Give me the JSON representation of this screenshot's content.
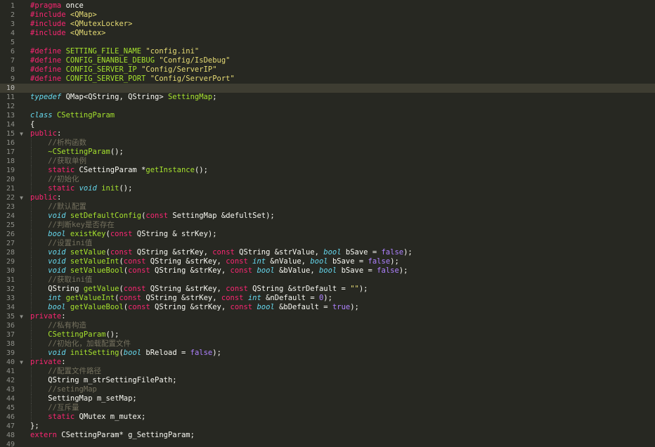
{
  "editor": {
    "theme": "monokai",
    "colors": {
      "background": "#272822",
      "active_line": "#3e3d32",
      "line_number": "#8f908a",
      "text": "#f8f8f2",
      "keyword": "#f92672",
      "type": "#66d9ef",
      "function": "#a6e22e",
      "string": "#e6db74",
      "number": "#ae81ff",
      "comment": "#75715e"
    },
    "active_line": 10,
    "lines": [
      {
        "n": "1",
        "tokens": [
          {
            "t": "#pragma",
            "c": "pp"
          },
          {
            "t": " once",
            "c": "tx"
          }
        ]
      },
      {
        "n": "2",
        "tokens": [
          {
            "t": "#include",
            "c": "pp"
          },
          {
            "t": " ",
            "c": "tx"
          },
          {
            "t": "<QMap>",
            "c": "str"
          }
        ]
      },
      {
        "n": "3",
        "tokens": [
          {
            "t": "#include",
            "c": "pp"
          },
          {
            "t": " ",
            "c": "tx"
          },
          {
            "t": "<QMutexLocker>",
            "c": "str"
          }
        ]
      },
      {
        "n": "4",
        "tokens": [
          {
            "t": "#include",
            "c": "pp"
          },
          {
            "t": " ",
            "c": "tx"
          },
          {
            "t": "<QMutex>",
            "c": "str"
          }
        ]
      },
      {
        "n": "5",
        "tokens": []
      },
      {
        "n": "6",
        "tokens": [
          {
            "t": "#define",
            "c": "pp"
          },
          {
            "t": " ",
            "c": "tx"
          },
          {
            "t": "SETTING_FILE_NAME",
            "c": "fn"
          },
          {
            "t": " ",
            "c": "tx"
          },
          {
            "t": "\"config.ini\"",
            "c": "str"
          }
        ]
      },
      {
        "n": "7",
        "tokens": [
          {
            "t": "#define",
            "c": "pp"
          },
          {
            "t": " ",
            "c": "tx"
          },
          {
            "t": "CONFIG_ENANBLE_DEBUG",
            "c": "fn"
          },
          {
            "t": " ",
            "c": "tx"
          },
          {
            "t": "\"Config/IsDebug\"",
            "c": "str"
          }
        ]
      },
      {
        "n": "8",
        "tokens": [
          {
            "t": "#define",
            "c": "pp"
          },
          {
            "t": " ",
            "c": "tx"
          },
          {
            "t": "CONFIG_SERVER_IP",
            "c": "fn"
          },
          {
            "t": " ",
            "c": "tx"
          },
          {
            "t": "\"Config/ServerIP\"",
            "c": "str"
          }
        ]
      },
      {
        "n": "9",
        "tokens": [
          {
            "t": "#define",
            "c": "pp"
          },
          {
            "t": " ",
            "c": "tx"
          },
          {
            "t": "CONFIG_SERVER_PORT",
            "c": "fn"
          },
          {
            "t": " ",
            "c": "tx"
          },
          {
            "t": "\"Config/ServerPort\"",
            "c": "str"
          }
        ]
      },
      {
        "n": "10",
        "tokens": []
      },
      {
        "n": "11",
        "tokens": [
          {
            "t": "typedef",
            "c": "type"
          },
          {
            "t": " QMap<QString, QString> ",
            "c": "tx"
          },
          {
            "t": "SettingMap",
            "c": "cls"
          },
          {
            "t": ";",
            "c": "tx"
          }
        ]
      },
      {
        "n": "12",
        "tokens": []
      },
      {
        "n": "13",
        "tokens": [
          {
            "t": "class",
            "c": "type"
          },
          {
            "t": " ",
            "c": "tx"
          },
          {
            "t": "CSettingParam",
            "c": "cls"
          }
        ]
      },
      {
        "n": "14",
        "tokens": [
          {
            "t": "{",
            "c": "tx"
          }
        ]
      },
      {
        "n": "15",
        "fold": true,
        "tokens": [
          {
            "t": "public",
            "c": "kw"
          },
          {
            "t": ":",
            "c": "tx"
          }
        ]
      },
      {
        "n": "16",
        "indent": 1,
        "tokens": [
          {
            "t": "    ",
            "c": "tx"
          },
          {
            "t": "//析构函数",
            "c": "cm"
          }
        ]
      },
      {
        "n": "17",
        "indent": 1,
        "tokens": [
          {
            "t": "    ",
            "c": "tx"
          },
          {
            "t": "~CSettingParam",
            "c": "fn"
          },
          {
            "t": "();",
            "c": "tx"
          }
        ]
      },
      {
        "n": "18",
        "indent": 1,
        "tokens": [
          {
            "t": "    ",
            "c": "tx"
          },
          {
            "t": "//获取单例",
            "c": "cm"
          }
        ]
      },
      {
        "n": "19",
        "indent": 1,
        "tokens": [
          {
            "t": "    ",
            "c": "tx"
          },
          {
            "t": "static",
            "c": "kw"
          },
          {
            "t": " CSettingParam *",
            "c": "tx"
          },
          {
            "t": "getInstance",
            "c": "fn"
          },
          {
            "t": "();",
            "c": "tx"
          }
        ]
      },
      {
        "n": "20",
        "indent": 1,
        "tokens": [
          {
            "t": "    ",
            "c": "tx"
          },
          {
            "t": "//初始化",
            "c": "cm"
          }
        ]
      },
      {
        "n": "21",
        "indent": 1,
        "tokens": [
          {
            "t": "    ",
            "c": "tx"
          },
          {
            "t": "static",
            "c": "kw"
          },
          {
            "t": " ",
            "c": "tx"
          },
          {
            "t": "void",
            "c": "type"
          },
          {
            "t": " ",
            "c": "tx"
          },
          {
            "t": "init",
            "c": "fn"
          },
          {
            "t": "();",
            "c": "tx"
          }
        ]
      },
      {
        "n": "22",
        "fold": true,
        "tokens": [
          {
            "t": "public",
            "c": "kw"
          },
          {
            "t": ":",
            "c": "tx"
          }
        ]
      },
      {
        "n": "23",
        "indent": 1,
        "tokens": [
          {
            "t": "    ",
            "c": "tx"
          },
          {
            "t": "//默认配置",
            "c": "cm"
          }
        ]
      },
      {
        "n": "24",
        "indent": 1,
        "tokens": [
          {
            "t": "    ",
            "c": "tx"
          },
          {
            "t": "void",
            "c": "type"
          },
          {
            "t": " ",
            "c": "tx"
          },
          {
            "t": "setDefaultConfig",
            "c": "fn"
          },
          {
            "t": "(",
            "c": "tx"
          },
          {
            "t": "const",
            "c": "kw"
          },
          {
            "t": " SettingMap &defultSet);",
            "c": "tx"
          }
        ]
      },
      {
        "n": "25",
        "indent": 1,
        "tokens": [
          {
            "t": "    ",
            "c": "tx"
          },
          {
            "t": "//判断key是否存在",
            "c": "cm"
          }
        ]
      },
      {
        "n": "26",
        "indent": 1,
        "tokens": [
          {
            "t": "    ",
            "c": "tx"
          },
          {
            "t": "bool",
            "c": "type"
          },
          {
            "t": " ",
            "c": "tx"
          },
          {
            "t": "existKey",
            "c": "fn"
          },
          {
            "t": "(",
            "c": "tx"
          },
          {
            "t": "const",
            "c": "kw"
          },
          {
            "t": " QString & strKey);",
            "c": "tx"
          }
        ]
      },
      {
        "n": "27",
        "indent": 1,
        "tokens": [
          {
            "t": "    ",
            "c": "tx"
          },
          {
            "t": "//设置ini值",
            "c": "cm"
          }
        ]
      },
      {
        "n": "28",
        "indent": 1,
        "tokens": [
          {
            "t": "    ",
            "c": "tx"
          },
          {
            "t": "void",
            "c": "type"
          },
          {
            "t": " ",
            "c": "tx"
          },
          {
            "t": "setValue",
            "c": "fn"
          },
          {
            "t": "(",
            "c": "tx"
          },
          {
            "t": "const",
            "c": "kw"
          },
          {
            "t": " QString &strKey, ",
            "c": "tx"
          },
          {
            "t": "const",
            "c": "kw"
          },
          {
            "t": " QString &strValue, ",
            "c": "tx"
          },
          {
            "t": "bool",
            "c": "type"
          },
          {
            "t": " bSave = ",
            "c": "tx"
          },
          {
            "t": "false",
            "c": "num"
          },
          {
            "t": ");",
            "c": "tx"
          }
        ]
      },
      {
        "n": "29",
        "indent": 1,
        "tokens": [
          {
            "t": "    ",
            "c": "tx"
          },
          {
            "t": "void",
            "c": "type"
          },
          {
            "t": " ",
            "c": "tx"
          },
          {
            "t": "setValueInt",
            "c": "fn"
          },
          {
            "t": "(",
            "c": "tx"
          },
          {
            "t": "const",
            "c": "kw"
          },
          {
            "t": " QString &strKey, ",
            "c": "tx"
          },
          {
            "t": "const",
            "c": "kw"
          },
          {
            "t": " ",
            "c": "tx"
          },
          {
            "t": "int",
            "c": "type"
          },
          {
            "t": " &nValue, ",
            "c": "tx"
          },
          {
            "t": "bool",
            "c": "type"
          },
          {
            "t": " bSave = ",
            "c": "tx"
          },
          {
            "t": "false",
            "c": "num"
          },
          {
            "t": ");",
            "c": "tx"
          }
        ]
      },
      {
        "n": "30",
        "indent": 1,
        "tokens": [
          {
            "t": "    ",
            "c": "tx"
          },
          {
            "t": "void",
            "c": "type"
          },
          {
            "t": " ",
            "c": "tx"
          },
          {
            "t": "setValueBool",
            "c": "fn"
          },
          {
            "t": "(",
            "c": "tx"
          },
          {
            "t": "const",
            "c": "kw"
          },
          {
            "t": " QString &strKey, ",
            "c": "tx"
          },
          {
            "t": "const",
            "c": "kw"
          },
          {
            "t": " ",
            "c": "tx"
          },
          {
            "t": "bool",
            "c": "type"
          },
          {
            "t": " &bValue, ",
            "c": "tx"
          },
          {
            "t": "bool",
            "c": "type"
          },
          {
            "t": " bSave = ",
            "c": "tx"
          },
          {
            "t": "false",
            "c": "num"
          },
          {
            "t": ");",
            "c": "tx"
          }
        ]
      },
      {
        "n": "31",
        "indent": 1,
        "tokens": [
          {
            "t": "    ",
            "c": "tx"
          },
          {
            "t": "//获取ini值",
            "c": "cm"
          }
        ]
      },
      {
        "n": "32",
        "indent": 1,
        "tokens": [
          {
            "t": "    ",
            "c": "tx"
          },
          {
            "t": "QString ",
            "c": "tx"
          },
          {
            "t": "getValue",
            "c": "fn"
          },
          {
            "t": "(",
            "c": "tx"
          },
          {
            "t": "const",
            "c": "kw"
          },
          {
            "t": " QString &strKey, ",
            "c": "tx"
          },
          {
            "t": "const",
            "c": "kw"
          },
          {
            "t": " QString &strDefault = ",
            "c": "tx"
          },
          {
            "t": "\"\"",
            "c": "str"
          },
          {
            "t": ");",
            "c": "tx"
          }
        ]
      },
      {
        "n": "33",
        "indent": 1,
        "tokens": [
          {
            "t": "    ",
            "c": "tx"
          },
          {
            "t": "int",
            "c": "type"
          },
          {
            "t": " ",
            "c": "tx"
          },
          {
            "t": "getValueInt",
            "c": "fn"
          },
          {
            "t": "(",
            "c": "tx"
          },
          {
            "t": "const",
            "c": "kw"
          },
          {
            "t": " QString &strKey, ",
            "c": "tx"
          },
          {
            "t": "const",
            "c": "kw"
          },
          {
            "t": " ",
            "c": "tx"
          },
          {
            "t": "int",
            "c": "type"
          },
          {
            "t": " &nDefault = ",
            "c": "tx"
          },
          {
            "t": "0",
            "c": "num"
          },
          {
            "t": ");",
            "c": "tx"
          }
        ]
      },
      {
        "n": "34",
        "indent": 1,
        "tokens": [
          {
            "t": "    ",
            "c": "tx"
          },
          {
            "t": "bool",
            "c": "type"
          },
          {
            "t": " ",
            "c": "tx"
          },
          {
            "t": "getValueBool",
            "c": "fn"
          },
          {
            "t": "(",
            "c": "tx"
          },
          {
            "t": "const",
            "c": "kw"
          },
          {
            "t": " QString &strKey, ",
            "c": "tx"
          },
          {
            "t": "const",
            "c": "kw"
          },
          {
            "t": " ",
            "c": "tx"
          },
          {
            "t": "bool",
            "c": "type"
          },
          {
            "t": " &bDefault = ",
            "c": "tx"
          },
          {
            "t": "true",
            "c": "num"
          },
          {
            "t": ");",
            "c": "tx"
          }
        ]
      },
      {
        "n": "35",
        "fold": true,
        "tokens": [
          {
            "t": "private",
            "c": "kw"
          },
          {
            "t": ":",
            "c": "tx"
          }
        ]
      },
      {
        "n": "36",
        "indent": 1,
        "tokens": [
          {
            "t": "    ",
            "c": "tx"
          },
          {
            "t": "//私有构造",
            "c": "cm"
          }
        ]
      },
      {
        "n": "37",
        "indent": 1,
        "tokens": [
          {
            "t": "    ",
            "c": "tx"
          },
          {
            "t": "CSettingParam",
            "c": "fn"
          },
          {
            "t": "();",
            "c": "tx"
          }
        ]
      },
      {
        "n": "38",
        "indent": 1,
        "tokens": [
          {
            "t": "    ",
            "c": "tx"
          },
          {
            "t": "//初始化，加载配置文件",
            "c": "cm"
          }
        ]
      },
      {
        "n": "39",
        "indent": 1,
        "tokens": [
          {
            "t": "    ",
            "c": "tx"
          },
          {
            "t": "void",
            "c": "type"
          },
          {
            "t": " ",
            "c": "tx"
          },
          {
            "t": "initSetting",
            "c": "fn"
          },
          {
            "t": "(",
            "c": "tx"
          },
          {
            "t": "bool",
            "c": "type"
          },
          {
            "t": " bReload = ",
            "c": "tx"
          },
          {
            "t": "false",
            "c": "num"
          },
          {
            "t": ");",
            "c": "tx"
          }
        ]
      },
      {
        "n": "40",
        "fold": true,
        "tokens": [
          {
            "t": "private",
            "c": "kw"
          },
          {
            "t": ":",
            "c": "tx"
          }
        ]
      },
      {
        "n": "41",
        "indent": 1,
        "tokens": [
          {
            "t": "    ",
            "c": "tx"
          },
          {
            "t": "//配置文件路径",
            "c": "cm"
          }
        ]
      },
      {
        "n": "42",
        "indent": 1,
        "tokens": [
          {
            "t": "    ",
            "c": "tx"
          },
          {
            "t": "QString m_strSettingFilePath;",
            "c": "tx"
          }
        ]
      },
      {
        "n": "43",
        "indent": 1,
        "tokens": [
          {
            "t": "    ",
            "c": "tx"
          },
          {
            "t": "//setingMap",
            "c": "cm"
          }
        ]
      },
      {
        "n": "44",
        "indent": 1,
        "tokens": [
          {
            "t": "    ",
            "c": "tx"
          },
          {
            "t": "SettingMap m_setMap;",
            "c": "tx"
          }
        ]
      },
      {
        "n": "45",
        "indent": 1,
        "tokens": [
          {
            "t": "    ",
            "c": "tx"
          },
          {
            "t": "//互斥量",
            "c": "cm"
          }
        ]
      },
      {
        "n": "46",
        "indent": 1,
        "tokens": [
          {
            "t": "    ",
            "c": "tx"
          },
          {
            "t": "static",
            "c": "kw"
          },
          {
            "t": " QMutex m_mutex;",
            "c": "tx"
          }
        ]
      },
      {
        "n": "47",
        "tokens": [
          {
            "t": "};",
            "c": "tx"
          }
        ]
      },
      {
        "n": "48",
        "tokens": [
          {
            "t": "extern",
            "c": "kw"
          },
          {
            "t": " CSettingParam* g_SettingParam;",
            "c": "tx"
          }
        ]
      },
      {
        "n": "49",
        "tokens": []
      }
    ]
  }
}
